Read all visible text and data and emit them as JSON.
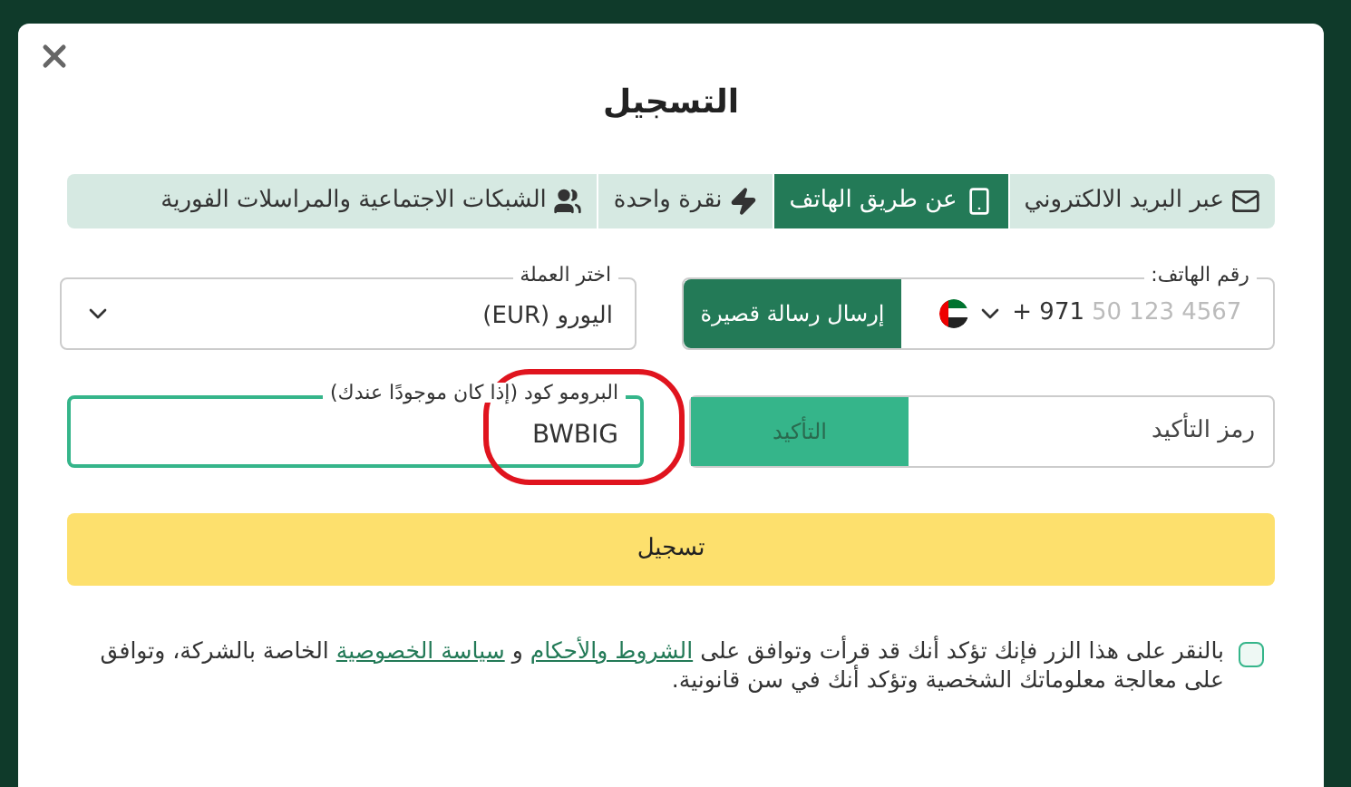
{
  "dialog": {
    "title": "التسجيل"
  },
  "tabs": [
    {
      "label": "عبر البريد الالكتروني",
      "kind": "email",
      "selected": false
    },
    {
      "label": "عن طريق الهاتف",
      "kind": "phone",
      "selected": true
    },
    {
      "label": "نقرة واحدة",
      "kind": "oneclick",
      "selected": false
    },
    {
      "label": "الشبكات الاجتماعية والمراسلات الفورية",
      "kind": "social",
      "selected": false
    }
  ],
  "phone": {
    "label": "رقم الهاتف:",
    "placeholder": "50 123 4567",
    "code": "+ 971",
    "send_button": "إرسال رسالة قصيرة"
  },
  "currency": {
    "label": "اختر العملة",
    "value": "اليورو (EUR)"
  },
  "confirmation": {
    "placeholder": "رمز التأكيد",
    "button": "التأكيد"
  },
  "promo": {
    "label": "البرومو كود (إذا كان موجودًا عندك)",
    "value": "BWBIG",
    "focused": true
  },
  "register_button": "تسجيل",
  "consent": {
    "checked": false,
    "text_before": "بالنقر على هذا الزر فإنك تؤكد أنك قد قرأت وتوافق على",
    "terms_link": "الشروط والأحكام",
    "and": "و",
    "privacy_link": "سياسة الخصوصية",
    "text_after": "الخاصة بالشركة، وتوافق على معالجة معلوماتك الشخصية وتؤكد أنك في سن قانونية."
  },
  "annotation": {
    "kind": "circle"
  }
}
